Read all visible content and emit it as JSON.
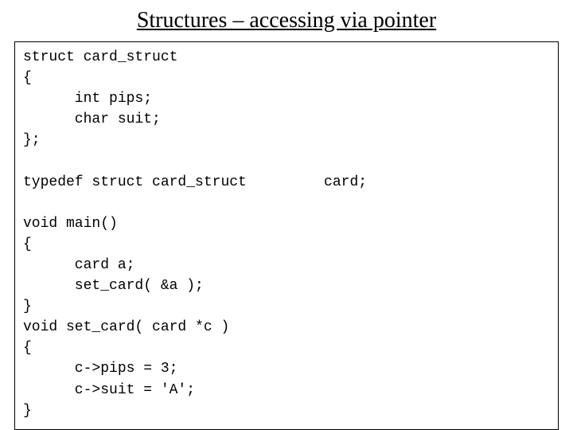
{
  "title": "Structures – accessing via pointer",
  "code": "struct card_struct\n{\n      int pips;\n      char suit;\n};\n\ntypedef struct card_struct         card;\n\nvoid main()\n{\n      card a;\n      set_card( &a );\n}\nvoid set_card( card *c )\n{\n      c->pips = 3;\n      c->suit = 'A';\n}"
}
